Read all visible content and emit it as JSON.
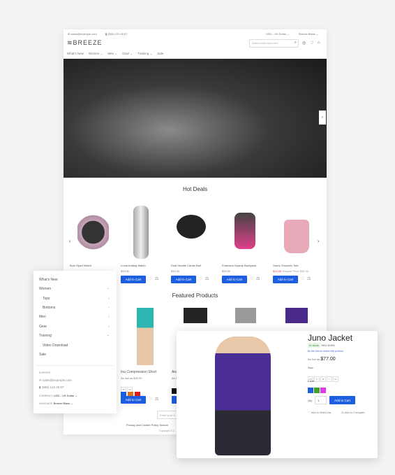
{
  "header": {
    "email": "sales@example.com",
    "phone": "(555) 123 45 67",
    "currency": "USD - US Dollar",
    "language": "Breeze Blank",
    "logo": "BREEZE",
    "search_placeholder": "Search entire store here..."
  },
  "nav": [
    "What's New",
    "Women",
    "Men",
    "Gear",
    "Training",
    "Sale"
  ],
  "hot_deals": {
    "title": "Hot Deals",
    "products": [
      {
        "name": "Bolo Sport Watch",
        "price": ""
      },
      {
        "name": "Luma Analog Watch",
        "price": "$43.00"
      },
      {
        "name": "Dual Handle Cardio Ball",
        "price": "$12.00"
      },
      {
        "name": "Endeavor Daytrip Backpack",
        "price": "$33.00"
      },
      {
        "name": "Savvy Shoulder Tote",
        "price": "$24.00",
        "regular": "Regular Price $32.00"
      }
    ],
    "add_to_cart": "Add to Cart"
  },
  "featured": {
    "title": "Featured Products",
    "product": {
      "name": "Ina Compression Short",
      "price": "As low as $49.00",
      "sizes": [
        "28",
        "29"
      ],
      "colors": [
        "#1d5fe0",
        "#e0731a",
        "#e01a1a"
      ]
    },
    "second_name": "Ana",
    "second_price": "As l"
  },
  "footer": {
    "newsletter_placeholder": "Enter your e",
    "links": "Privacy and Cookie Policy  Search",
    "copyright": "Copyright © 2"
  },
  "mobile_menu": {
    "items": [
      "What's New",
      "Women",
      "Tops",
      "Bottoms",
      "Men",
      "Gear",
      "Training",
      "Video Download",
      "Sale"
    ],
    "support_label": "SUPPORT",
    "email": "sales@example.com",
    "phone": "(555) 123 45 67",
    "currency_label": "CURRENCY",
    "currency": "USD - US Dollar",
    "language_label": "LANGUAGE",
    "language": "Breeze Blank"
  },
  "product_panel": {
    "title": "Juno Jacket",
    "stock": "In stock",
    "sku": "SKU WJ06",
    "review": "Be the first to review this product",
    "as_low_as": "As low as",
    "price": "$77.00",
    "size_label": "Size",
    "sizes": [
      "XS",
      "S",
      "M",
      "L",
      "XL"
    ],
    "color_label": "Color",
    "colors": [
      "#1d5fe0",
      "#3fa32a",
      "#e03ae6"
    ],
    "qty_label": "Qty",
    "qty": "1",
    "add_to_cart": "Add to Cart",
    "wishlist": "Add to Wish List",
    "compare": "Add to Compare"
  }
}
